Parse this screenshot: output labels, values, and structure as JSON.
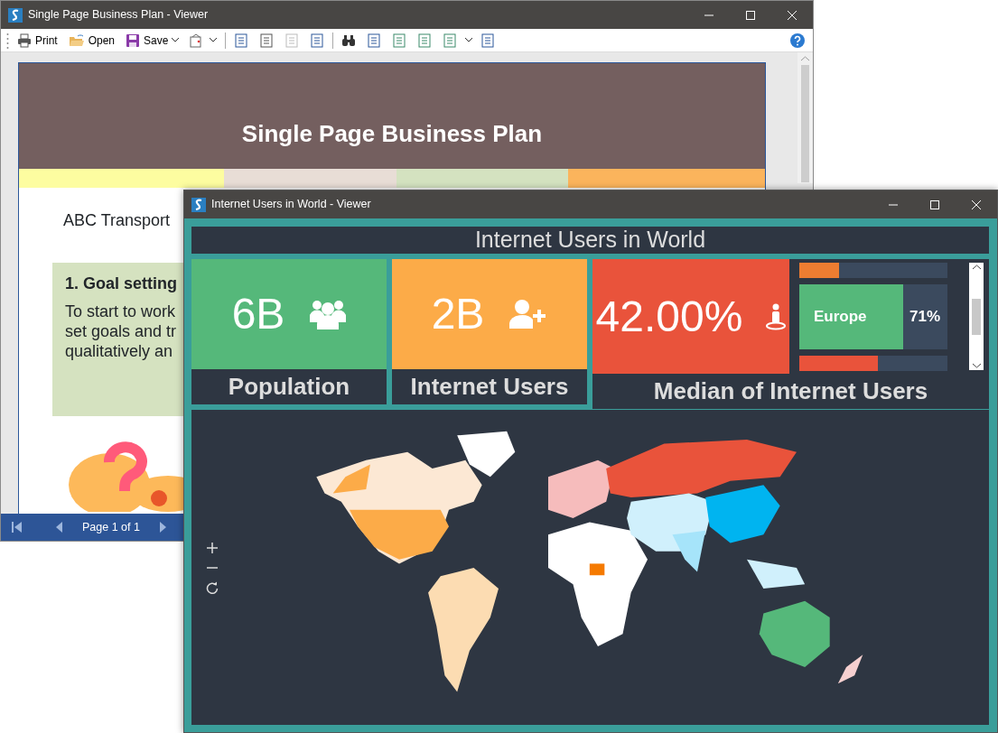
{
  "report_viewer": {
    "title": "Single Page Business Plan - Viewer",
    "toolbar": [
      {
        "kind": "print",
        "label": "Print",
        "dropdown": false
      },
      {
        "kind": "open",
        "label": "Open",
        "dropdown": false
      },
      {
        "kind": "save",
        "label": "Save",
        "dropdown": true
      }
    ],
    "page": {
      "title": "Single Page Business Plan",
      "company": "ABC Transport",
      "goal_heading": "1. Goal setting",
      "goal_lines": [
        "To start to work",
        "set goals and tr",
        "qualitatively an"
      ]
    },
    "pager": "Page 1 of 1"
  },
  "dashboard": {
    "title": "Internet Users in World - Viewer",
    "heading": "Internet Users in World",
    "tiles": [
      {
        "kind": "population",
        "value": "6B",
        "label": "Population",
        "color": "#55b87a"
      },
      {
        "kind": "users",
        "value": "2B",
        "label": "Internet Users",
        "color": "#fcab48"
      },
      {
        "kind": "median",
        "value": "42.00%",
        "label": "Median of Internet Users",
        "color": "#e9533b"
      }
    ],
    "regions": [
      {
        "color": "#ed7d31",
        "level": 0.27
      },
      {
        "name": "Europe",
        "value": "71%",
        "color": "#55b87a",
        "level": 0.7
      },
      {
        "color": "#e9533b",
        "level": 0.53
      }
    ]
  }
}
